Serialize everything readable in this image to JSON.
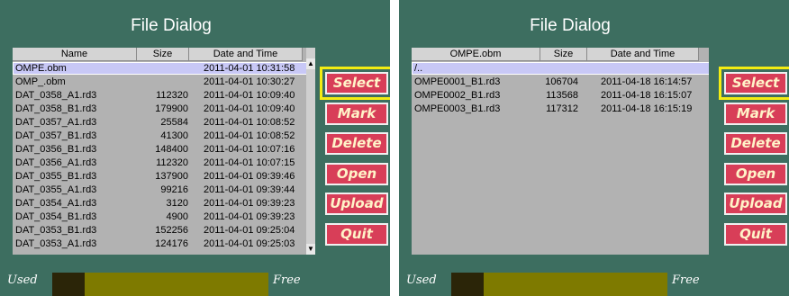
{
  "left": {
    "title": "File Dialog",
    "columns": [
      "Name",
      "Size",
      "Date and Time"
    ],
    "rows": [
      {
        "name": "OMPE.obm",
        "size": "",
        "date": "2011-04-01 10:31:58",
        "selected": true
      },
      {
        "name": "OMP_.obm",
        "size": "",
        "date": "2011-04-01 10:30:27",
        "selected": false
      },
      {
        "name": "DAT_0358_A1.rd3",
        "size": "112320",
        "date": "2011-04-01 10:09:40",
        "selected": false
      },
      {
        "name": "DAT_0358_B1.rd3",
        "size": "179900",
        "date": "2011-04-01 10:09:40",
        "selected": false
      },
      {
        "name": "DAT_0357_A1.rd3",
        "size": "25584",
        "date": "2011-04-01 10:08:52",
        "selected": false
      },
      {
        "name": "DAT_0357_B1.rd3",
        "size": "41300",
        "date": "2011-04-01 10:08:52",
        "selected": false
      },
      {
        "name": "DAT_0356_B1.rd3",
        "size": "148400",
        "date": "2011-04-01 10:07:16",
        "selected": false
      },
      {
        "name": "DAT_0356_A1.rd3",
        "size": "112320",
        "date": "2011-04-01 10:07:15",
        "selected": false
      },
      {
        "name": "DAT_0355_B1.rd3",
        "size": "137900",
        "date": "2011-04-01 09:39:46",
        "selected": false
      },
      {
        "name": "DAT_0355_A1.rd3",
        "size": "99216",
        "date": "2011-04-01 09:39:44",
        "selected": false
      },
      {
        "name": "DAT_0354_A1.rd3",
        "size": "3120",
        "date": "2011-04-01 09:39:23",
        "selected": false
      },
      {
        "name": "DAT_0354_B1.rd3",
        "size": "4900",
        "date": "2011-04-01 09:39:23",
        "selected": false
      },
      {
        "name": "DAT_0353_B1.rd3",
        "size": "152256",
        "date": "2011-04-01 09:25:04",
        "selected": false
      },
      {
        "name": "DAT_0353_A1.rd3",
        "size": "124176",
        "date": "2011-04-01 09:25:03",
        "selected": false
      }
    ],
    "scrollbar": {
      "up_icon": "triangle-up",
      "down_icon": "triangle-down"
    },
    "buttons": [
      "Select",
      "Mark",
      "Delete",
      "Open",
      "Upload",
      "Quit"
    ],
    "focused_button": "Select",
    "storage": {
      "used_label": "Used",
      "free_label": "Free",
      "used_fraction": 0.15
    }
  },
  "right": {
    "title": "File Dialog",
    "columns": [
      "OMPE.obm",
      "Size",
      "Date and Time"
    ],
    "rows": [
      {
        "name": "/..",
        "size": "",
        "date": "",
        "selected": true
      },
      {
        "name": "OMPE0001_B1.rd3",
        "size": "106704",
        "date": "2011-04-18 16:14:57",
        "selected": false
      },
      {
        "name": "OMPE0002_B1.rd3",
        "size": "113568",
        "date": "2011-04-18 16:15:07",
        "selected": false
      },
      {
        "name": "OMPE0003_B1.rd3",
        "size": "117312",
        "date": "2011-04-18 16:15:19",
        "selected": false
      }
    ],
    "buttons": [
      "Select",
      "Mark",
      "Delete",
      "Open",
      "Upload",
      "Quit"
    ],
    "focused_button": "Select",
    "storage": {
      "used_label": "Used",
      "free_label": "Free",
      "used_fraction": 0.15
    }
  },
  "colors": {
    "background": "#3d6e60",
    "button": "#d83e58",
    "focus": "#f4ec12",
    "selected_row": "#c8c8f6",
    "used": "#2b2508",
    "free": "#7e7a00"
  }
}
